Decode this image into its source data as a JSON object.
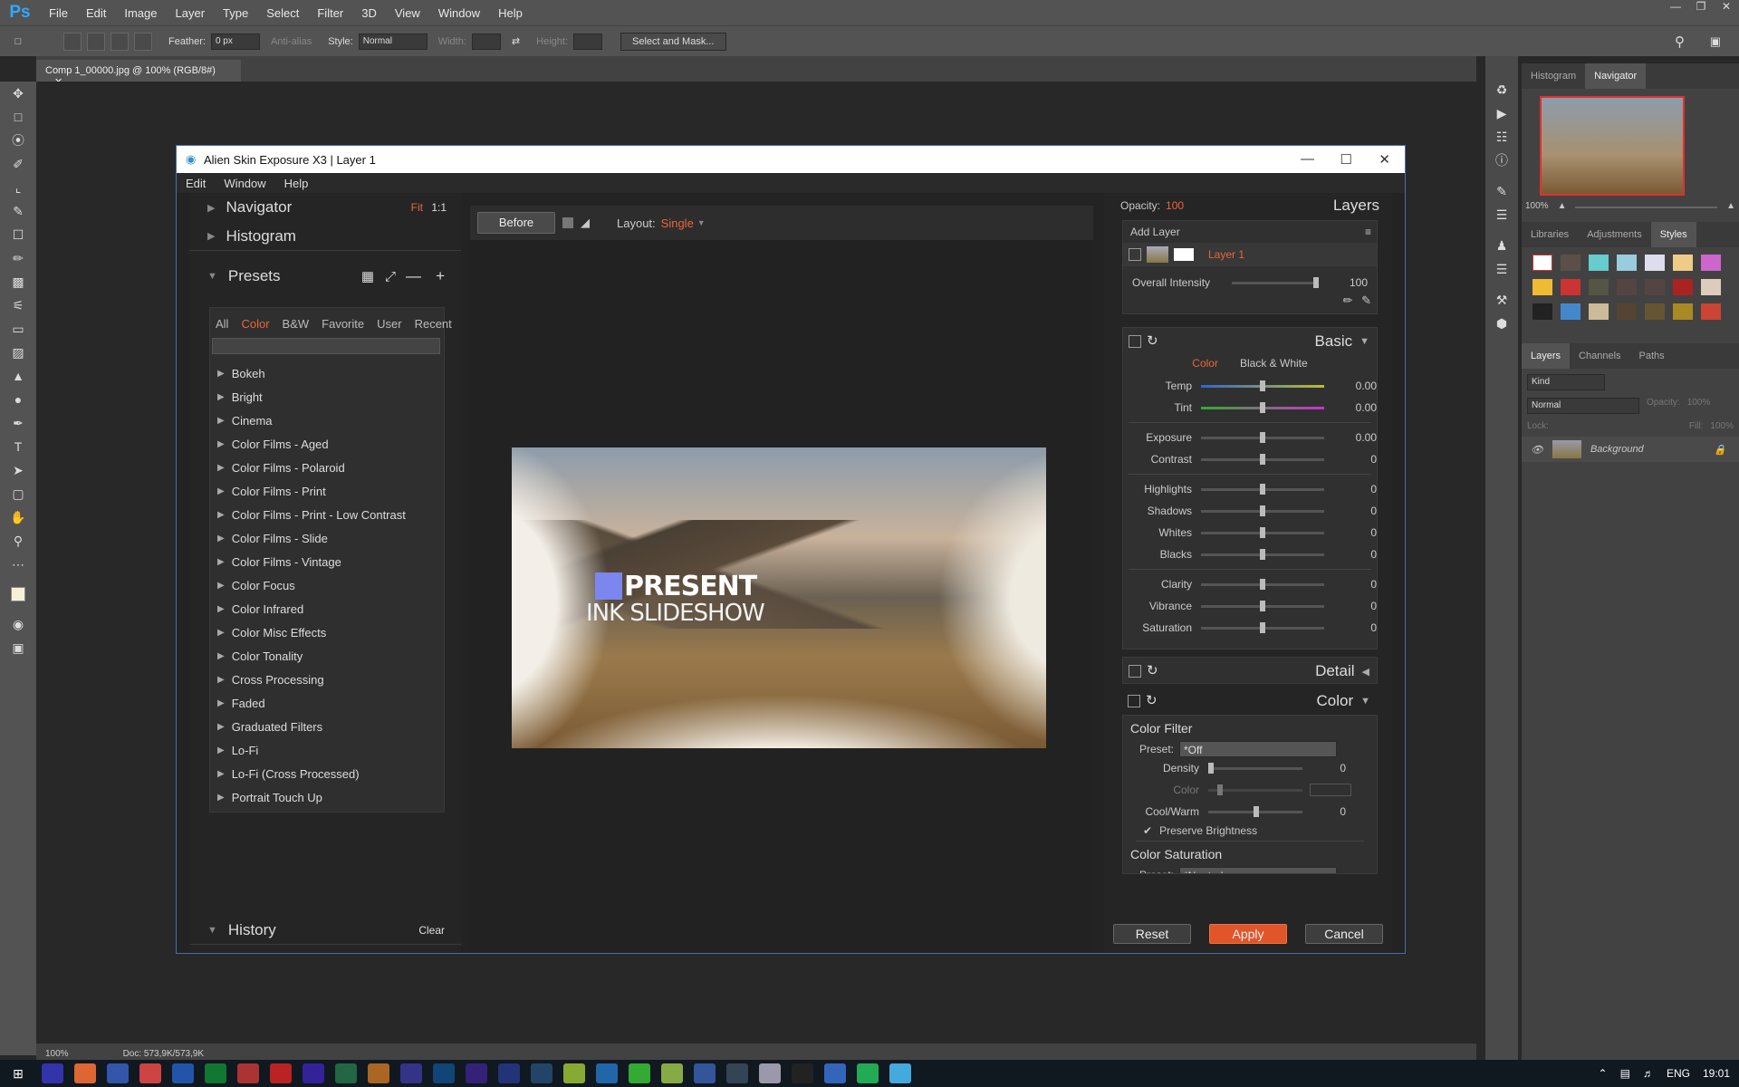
{
  "app": {
    "logo": "Ps",
    "menu": [
      "File",
      "Edit",
      "Image",
      "Layer",
      "Type",
      "Select",
      "Filter",
      "3D",
      "View",
      "Window",
      "Help"
    ]
  },
  "options_bar": {
    "feather_label": "Feather:",
    "feather_value": "0 px",
    "anti_alias": "Anti-alias",
    "style_label": "Style:",
    "style_value": "Normal",
    "width_label": "Width:",
    "height_label": "Height:",
    "select_mask": "Select and Mask..."
  },
  "document": {
    "tab": "Comp 1_00000.jpg @ 100% (RGB/8#)",
    "zoom": "100%",
    "doc_size": "Doc: 573,9K/573,9K"
  },
  "right_panels": {
    "top_tabs": [
      "Histogram",
      "Navigator"
    ],
    "nav_zoom": "100%",
    "style_tabs": [
      "Libraries",
      "Adjustments",
      "Styles"
    ],
    "layer_tabs": [
      "Layers",
      "Channels",
      "Paths"
    ],
    "kind": "Kind",
    "blend": "Normal",
    "opacity_label": "Opacity:",
    "opacity_value": "100%",
    "lock_label": "Lock:",
    "fill_label": "Fill:",
    "fill_value": "100%",
    "layer_name": "Background"
  },
  "dialog": {
    "title": "Alien Skin Exposure X3 | Layer 1",
    "menu": [
      "Edit",
      "Window",
      "Help"
    ],
    "left": {
      "navigator": "Navigator",
      "fit": "Fit",
      "one_to_one": "1:1",
      "histogram": "Histogram",
      "presets": "Presets",
      "filter_tabs": [
        "All",
        "Color",
        "B&W",
        "Favorite",
        "User",
        "Recent"
      ],
      "preset_list": [
        "Bokeh",
        "Bright",
        "Cinema",
        "Color Films - Aged",
        "Color Films - Polaroid",
        "Color Films - Print",
        "Color Films - Print - Low Contrast",
        "Color Films - Slide",
        "Color Films - Vintage",
        "Color Focus",
        "Color Infrared",
        "Color Misc Effects",
        "Color Tonality",
        "Cross Processing",
        "Faded",
        "Graduated Filters",
        "Lo-Fi",
        "Lo-Fi (Cross Processed)",
        "Portrait Touch Up"
      ],
      "history": "History",
      "clear": "Clear"
    },
    "center": {
      "before": "Before",
      "layout_label": "Layout:",
      "layout_value": "Single",
      "photo_title1": "PRESENT",
      "photo_title2": "INK SLIDESHOW"
    },
    "right": {
      "opacity_label": "Opacity:",
      "opacity_value": "100",
      "layers": "Layers",
      "add_layer": "Add Layer",
      "layer1": "Layer 1",
      "overall_intensity": "Overall Intensity",
      "overall_value": "100",
      "basic": "Basic",
      "color_tab": "Color",
      "bw_tab": "Black & White",
      "sliders": [
        {
          "label": "Temp",
          "value": "0.00"
        },
        {
          "label": "Tint",
          "value": "0.00"
        },
        {
          "label": "Exposure",
          "value": "0.00"
        },
        {
          "label": "Contrast",
          "value": "0"
        },
        {
          "label": "Highlights",
          "value": "0"
        },
        {
          "label": "Shadows",
          "value": "0"
        },
        {
          "label": "Whites",
          "value": "0"
        },
        {
          "label": "Blacks",
          "value": "0"
        },
        {
          "label": "Clarity",
          "value": "0"
        },
        {
          "label": "Vibrance",
          "value": "0"
        },
        {
          "label": "Saturation",
          "value": "0"
        }
      ],
      "detail": "Detail",
      "color_section": "Color",
      "color_filter": "Color Filter",
      "preset_label": "Preset:",
      "cf_preset": "*Off",
      "density_label": "Density",
      "density_value": "0",
      "color_label": "Color",
      "coolwarm_label": "Cool/Warm",
      "coolwarm_value": "0",
      "preserve": "Preserve Brightness",
      "color_saturation": "Color Saturation",
      "cs_preset": "*Neutral"
    },
    "buttons": {
      "reset": "Reset",
      "apply": "Apply",
      "cancel": "Cancel"
    }
  },
  "taskbar": {
    "lang": "ENG",
    "time": "19:01"
  },
  "colors": {
    "accent": "#e9663a",
    "apply": "#e0562a",
    "ps_blue": "#31a8ff"
  }
}
